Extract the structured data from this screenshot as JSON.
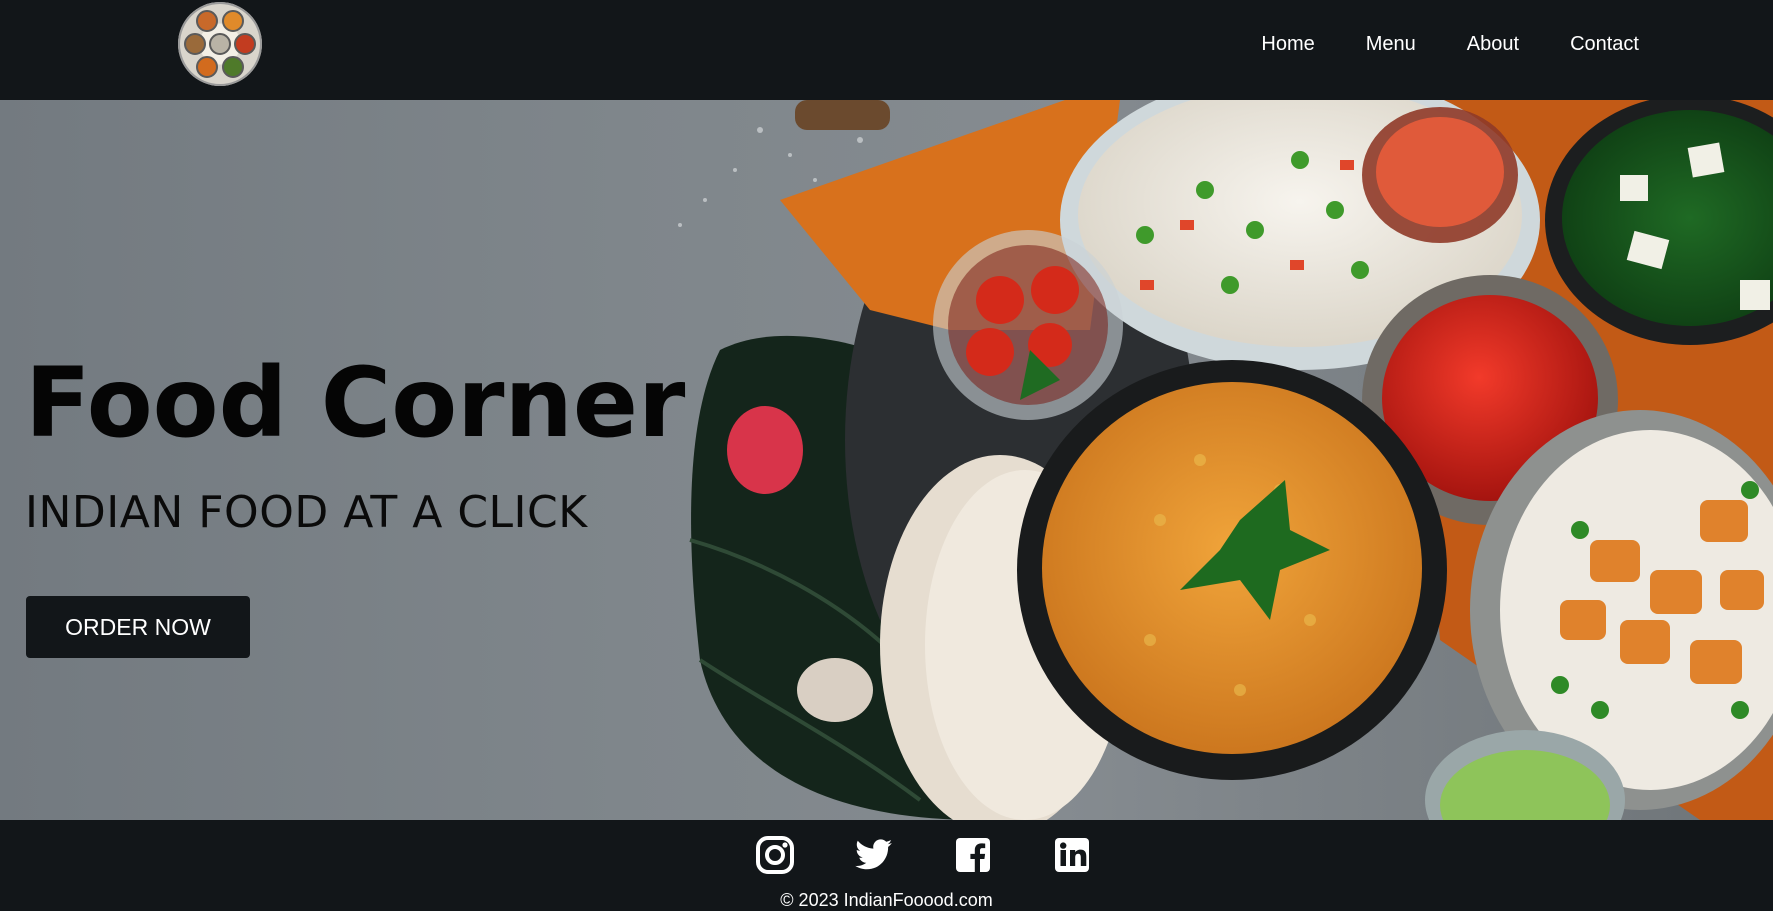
{
  "header": {
    "logo_icon": "thali-plate-logo",
    "nav": [
      {
        "label": "Home"
      },
      {
        "label": "Menu"
      },
      {
        "label": "About"
      },
      {
        "label": "Contact"
      }
    ]
  },
  "hero": {
    "title": "Food Corner",
    "subtitle": "INDIAN FOOD AT A CLICK",
    "cta_label": "ORDER NOW",
    "image_description_icon": "indian-food-spread-photo"
  },
  "footer": {
    "social": [
      {
        "icon": "instagram-icon"
      },
      {
        "icon": "twitter-icon"
      },
      {
        "icon": "facebook-icon"
      },
      {
        "icon": "linkedin-icon"
      }
    ],
    "copyright": "© 2023 IndianFooood.com"
  },
  "colors": {
    "bar_background": "#121619",
    "hero_background": "#7f868b",
    "text_dark": "#050505",
    "text_light": "#ffffff"
  }
}
